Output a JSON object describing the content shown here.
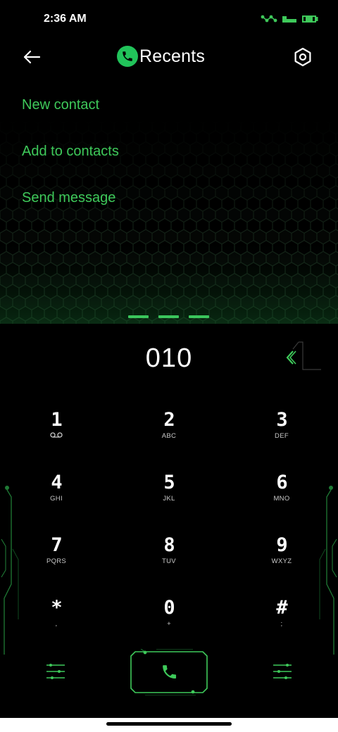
{
  "status_bar": {
    "time": "2:36 AM"
  },
  "header": {
    "title": "Recents",
    "back_icon": "arrow-left-icon",
    "settings_icon": "hexagon-settings-icon"
  },
  "actions": [
    {
      "label": "New contact"
    },
    {
      "label": "Add to contacts"
    },
    {
      "label": "Send message"
    }
  ],
  "dialer": {
    "number": "010"
  },
  "keypad": [
    {
      "digit": "1",
      "sub": "voicemail-icon"
    },
    {
      "digit": "2",
      "sub": "ABC"
    },
    {
      "digit": "3",
      "sub": "DEF"
    },
    {
      "digit": "4",
      "sub": "GHI"
    },
    {
      "digit": "5",
      "sub": "JKL"
    },
    {
      "digit": "6",
      "sub": "MNO"
    },
    {
      "digit": "7",
      "sub": "PQRS"
    },
    {
      "digit": "8",
      "sub": "TUV"
    },
    {
      "digit": "9",
      "sub": "WXYZ"
    },
    {
      "digit": "*",
      "sub": ","
    },
    {
      "digit": "0",
      "sub": "+"
    },
    {
      "digit": "#",
      "sub": ";"
    }
  ],
  "colors": {
    "accent": "#3ec95a",
    "background": "#000000",
    "text": "#ffffff"
  }
}
